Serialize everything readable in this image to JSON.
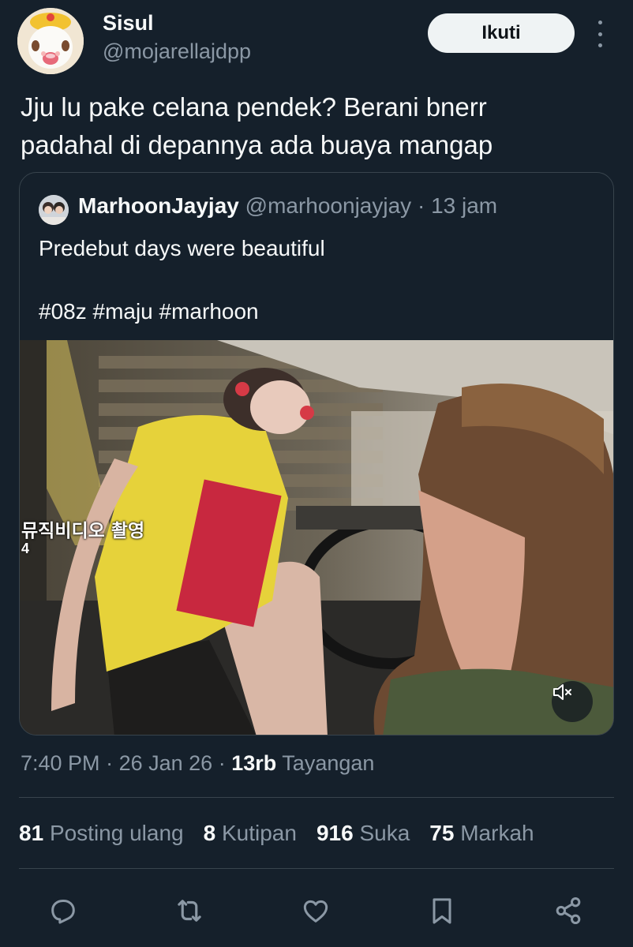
{
  "author": {
    "display_name": "Sisul",
    "handle": "@mojarellajdpp"
  },
  "follow_label": "Ikuti",
  "tweet": {
    "lines": [
      "Jju lu pake celana pendek? Berani bnerr",
      "padahal di depannya ada buaya mangap"
    ]
  },
  "quote": {
    "name": "MarhoonJayjay",
    "handle": "@marhoonjayjay",
    "separator": "·",
    "time": "13 jam",
    "text_lines": [
      "Predebut days were beautiful",
      "",
      "#08z #maju #marhoon"
    ],
    "video": {
      "caption": "뮤직비디오 촬영",
      "caption_sub": "4",
      "mute_icon": "speaker-muted-icon"
    }
  },
  "meta": {
    "time": "7:40 PM",
    "sep1": "·",
    "date": "26 Jan 26",
    "sep2": "·",
    "views_count": "13rb",
    "views_label": "Tayangan"
  },
  "stats": [
    {
      "count": "81",
      "label": "Posting ulang"
    },
    {
      "count": "8",
      "label": "Kutipan"
    },
    {
      "count": "916",
      "label": "Suka"
    },
    {
      "count": "75",
      "label": "Markah"
    }
  ],
  "actions": [
    "reply-icon",
    "retweet-icon",
    "like-icon",
    "bookmark-icon",
    "share-icon"
  ],
  "colors": {
    "background": "#15202b",
    "text": "#f7f9f9",
    "muted": "#8b98a5",
    "border": "#38444d",
    "button_bg": "#eff3f4"
  }
}
